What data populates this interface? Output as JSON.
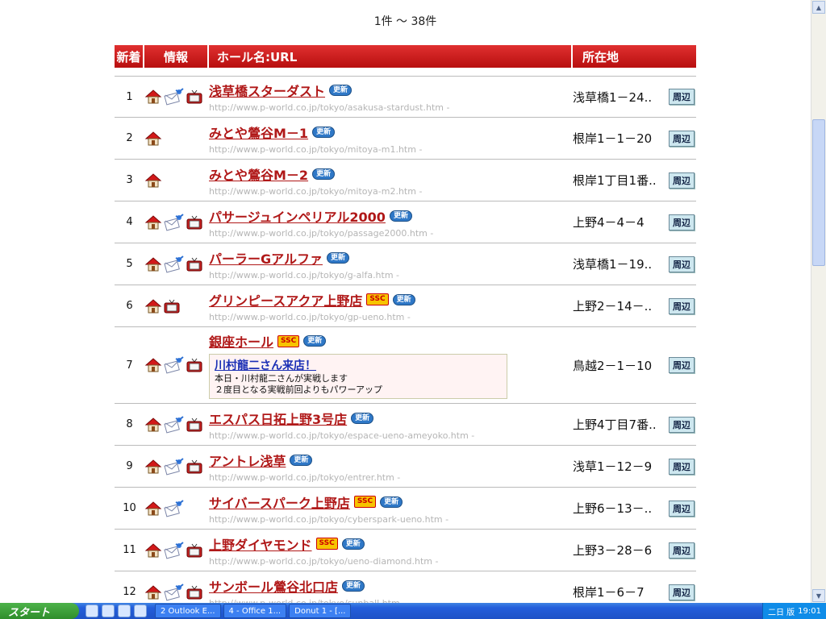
{
  "results": {
    "count_text": "1件 〜 38件"
  },
  "table": {
    "headers": {
      "new": "新着",
      "info": "情報",
      "name_url": "ホール名:URL",
      "location": "所在地"
    },
    "nearby_label": "周辺",
    "new_badge": "更新",
    "ssc_badge": "SSC",
    "rows": [
      {
        "num": "1",
        "name": "浅草橋スターダスト",
        "url": "http://www.p-world.co.jp/tokyo/asakusa-stardust.htm -",
        "location": "浅草橋1－24..",
        "icons": [
          "home",
          "mail",
          "tv"
        ],
        "ssc": false
      },
      {
        "num": "2",
        "name": "みとや鶯谷M－1",
        "url": "http://www.p-world.co.jp/tokyo/mitoya-m1.htm -",
        "location": "根岸1－1－20",
        "icons": [
          "home"
        ],
        "ssc": false
      },
      {
        "num": "3",
        "name": "みとや鶯谷M－2",
        "url": "http://www.p-world.co.jp/tokyo/mitoya-m2.htm -",
        "location": "根岸1丁目1番..",
        "icons": [
          "home"
        ],
        "ssc": false
      },
      {
        "num": "4",
        "name": "パサージュインペリアル2000",
        "url": "http://www.p-world.co.jp/tokyo/passage2000.htm -",
        "location": "上野4－4－4",
        "icons": [
          "home",
          "mail",
          "tv"
        ],
        "ssc": false
      },
      {
        "num": "5",
        "name": "パーラーGアルファ",
        "url": "http://www.p-world.co.jp/tokyo/g-alfa.htm -",
        "location": "浅草橋1－19..",
        "icons": [
          "home",
          "mail",
          "tv"
        ],
        "ssc": false
      },
      {
        "num": "6",
        "name": "グリンピースアクア上野店",
        "url": "http://www.p-world.co.jp/tokyo/gp-ueno.htm -",
        "location": "上野2－14－..",
        "icons": [
          "home",
          "tv"
        ],
        "ssc": true
      },
      {
        "num": "7",
        "name": "銀座ホール",
        "url": "",
        "location": "鳥越2－1－10",
        "icons": [
          "home",
          "mail",
          "tv"
        ],
        "ssc": true,
        "event": {
          "title": "川村龍二さん来店！",
          "line1": "本日・川村龍二さんが実戦します",
          "line2": "２度目となる実戦前回よりもパワーアップ"
        }
      },
      {
        "num": "8",
        "name": "エスパス日拓上野3号店",
        "url": "http://www.p-world.co.jp/tokyo/espace-ueno-ameyoko.htm -",
        "location": "上野4丁目7番..",
        "icons": [
          "home",
          "mail",
          "tv"
        ],
        "ssc": false
      },
      {
        "num": "9",
        "name": "アントレ浅草",
        "url": "http://www.p-world.co.jp/tokyo/entrer.htm -",
        "location": "浅草1－12－9",
        "icons": [
          "home",
          "mail",
          "tv"
        ],
        "ssc": false
      },
      {
        "num": "10",
        "name": "サイバースパーク上野店",
        "url": "http://www.p-world.co.jp/tokyo/cyberspark-ueno.htm -",
        "location": "上野6－13－..",
        "icons": [
          "home",
          "mail"
        ],
        "ssc": true
      },
      {
        "num": "11",
        "name": "上野ダイヤモンド",
        "url": "http://www.p-world.co.jp/tokyo/ueno-diamond.htm -",
        "location": "上野3－28－6",
        "icons": [
          "home",
          "mail",
          "tv"
        ],
        "ssc": true
      },
      {
        "num": "12",
        "name": "サンボール鶯谷北口店",
        "url": "http://www.p-world.co.jp/tokyo/sunball.htm -",
        "location": "根岸1－6－7",
        "icons": [
          "home",
          "mail",
          "tv"
        ],
        "ssc": false
      }
    ]
  },
  "taskbar": {
    "start_label": "スタート",
    "tasks": [
      "2 Outlook E...",
      "4 - Office 1...",
      "Donut 1 - [...",
      ""
    ],
    "tray_text": "二日 版",
    "clock": "19:01"
  },
  "colors": {
    "header_red": "#c41a1a",
    "link_red": "#b01818",
    "url_gray": "#b5b5b5"
  }
}
